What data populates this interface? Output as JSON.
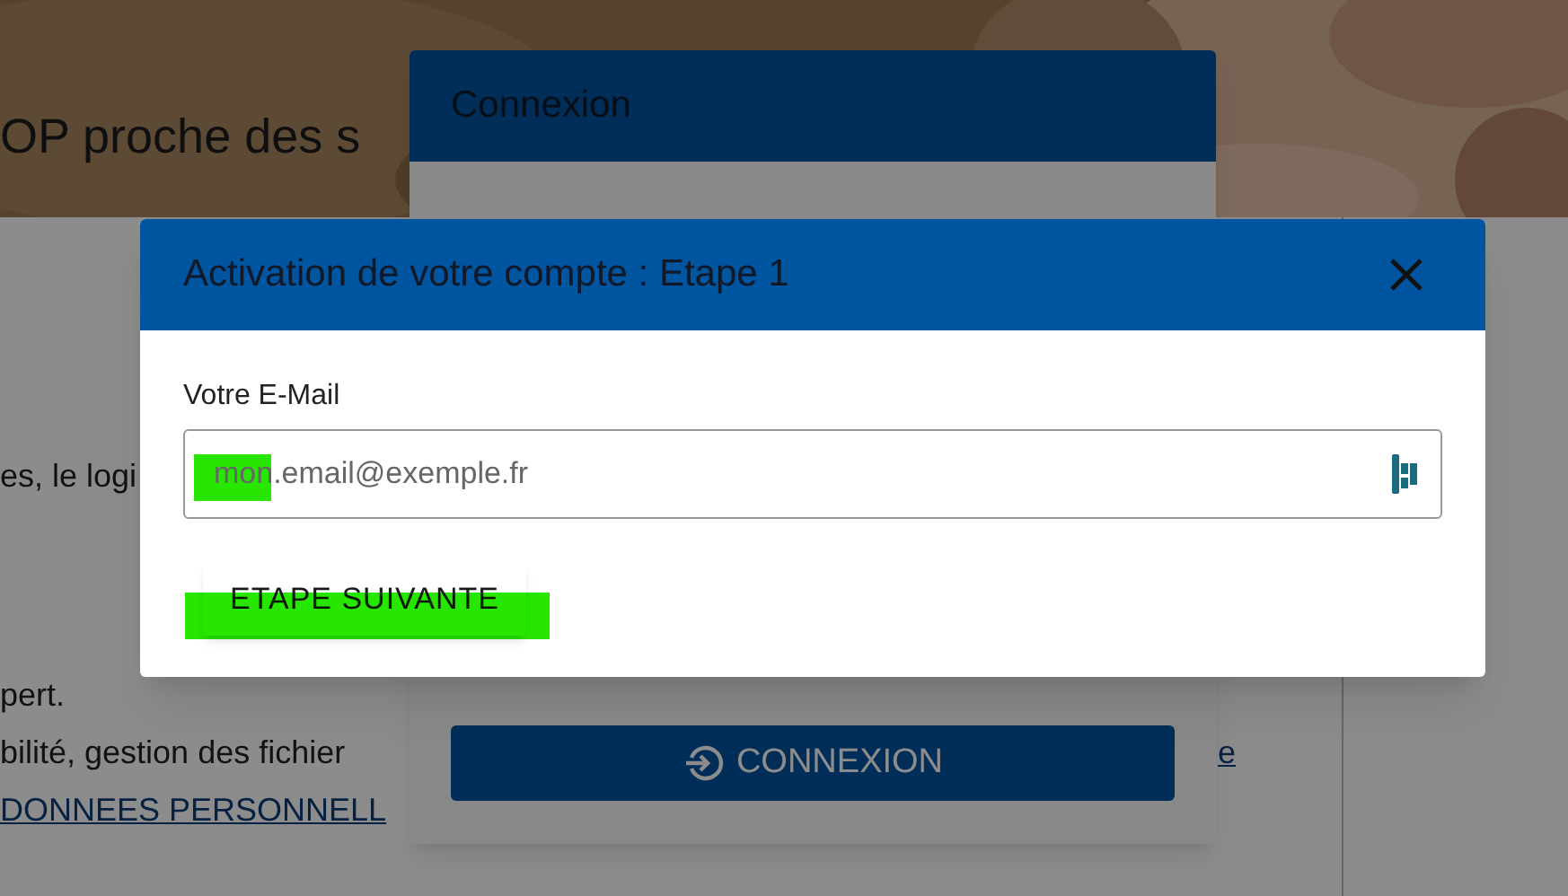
{
  "background_page": {
    "tagline": "OP proche des s",
    "text_lines": [
      "es, le logi",
      "pert.",
      "bilité, gestion des fichier"
    ],
    "link": "DONNEES PERSONNELL",
    "link_right": "e"
  },
  "login_dialog": {
    "title": "Connexion",
    "button": "CONNEXION"
  },
  "activation_dialog": {
    "title": "Activation de votre compte : Etape 1",
    "email_field": {
      "label": "Votre E-Mail",
      "placeholder": "mon.email@exemple.fr"
    },
    "button": "ETAPE SUIVANTE"
  }
}
